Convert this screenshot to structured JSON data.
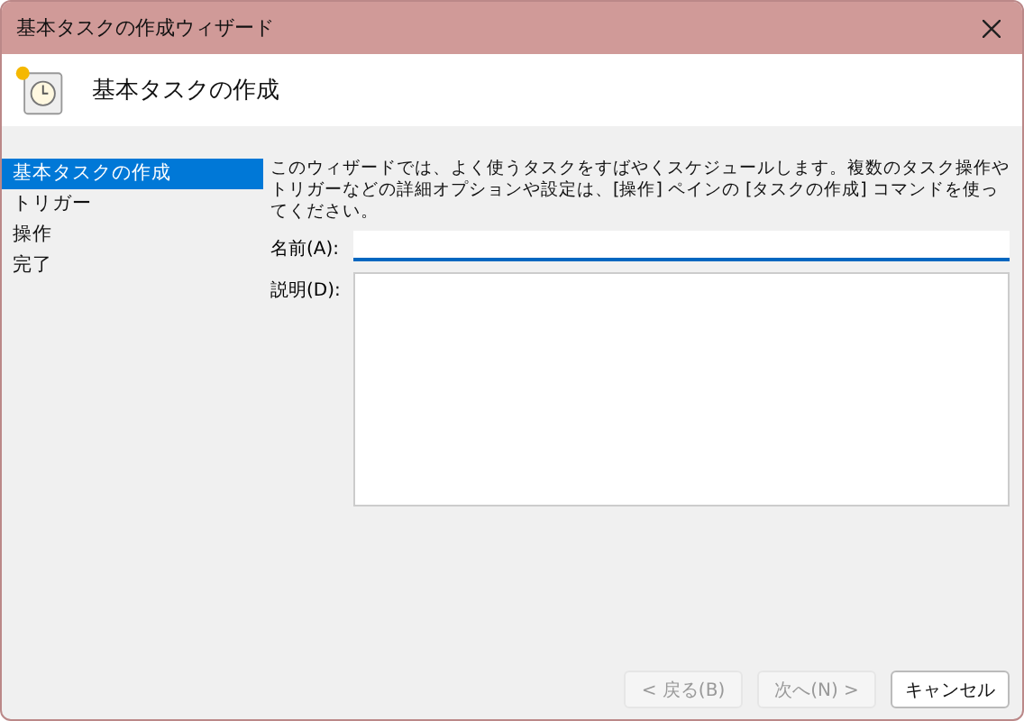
{
  "window": {
    "title": "基本タスクの作成ウィザード"
  },
  "header": {
    "title": "基本タスクの作成"
  },
  "sidebar": {
    "items": [
      {
        "label": "基本タスクの作成",
        "selected": true
      },
      {
        "label": "トリガー",
        "selected": false
      },
      {
        "label": "操作",
        "selected": false
      },
      {
        "label": "完了",
        "selected": false
      }
    ]
  },
  "description": "このウィザードでは、よく使うタスクをすばやくスケジュールします。複数のタスク操作やトリガーなどの詳細オプションや設定は、[操作] ペインの [タスクの作成] コマンドを使ってください。",
  "fields": [
    {
      "label": "名前(A):",
      "kind": "line"
    },
    {
      "label": "説明(D):",
      "kind": "area"
    }
  ],
  "buttons": [
    {
      "label": "< 戻る(B)",
      "disabled": true
    },
    {
      "label": "次へ(N) >",
      "disabled": true
    },
    {
      "label": "キャンセル",
      "disabled": false
    }
  ]
}
